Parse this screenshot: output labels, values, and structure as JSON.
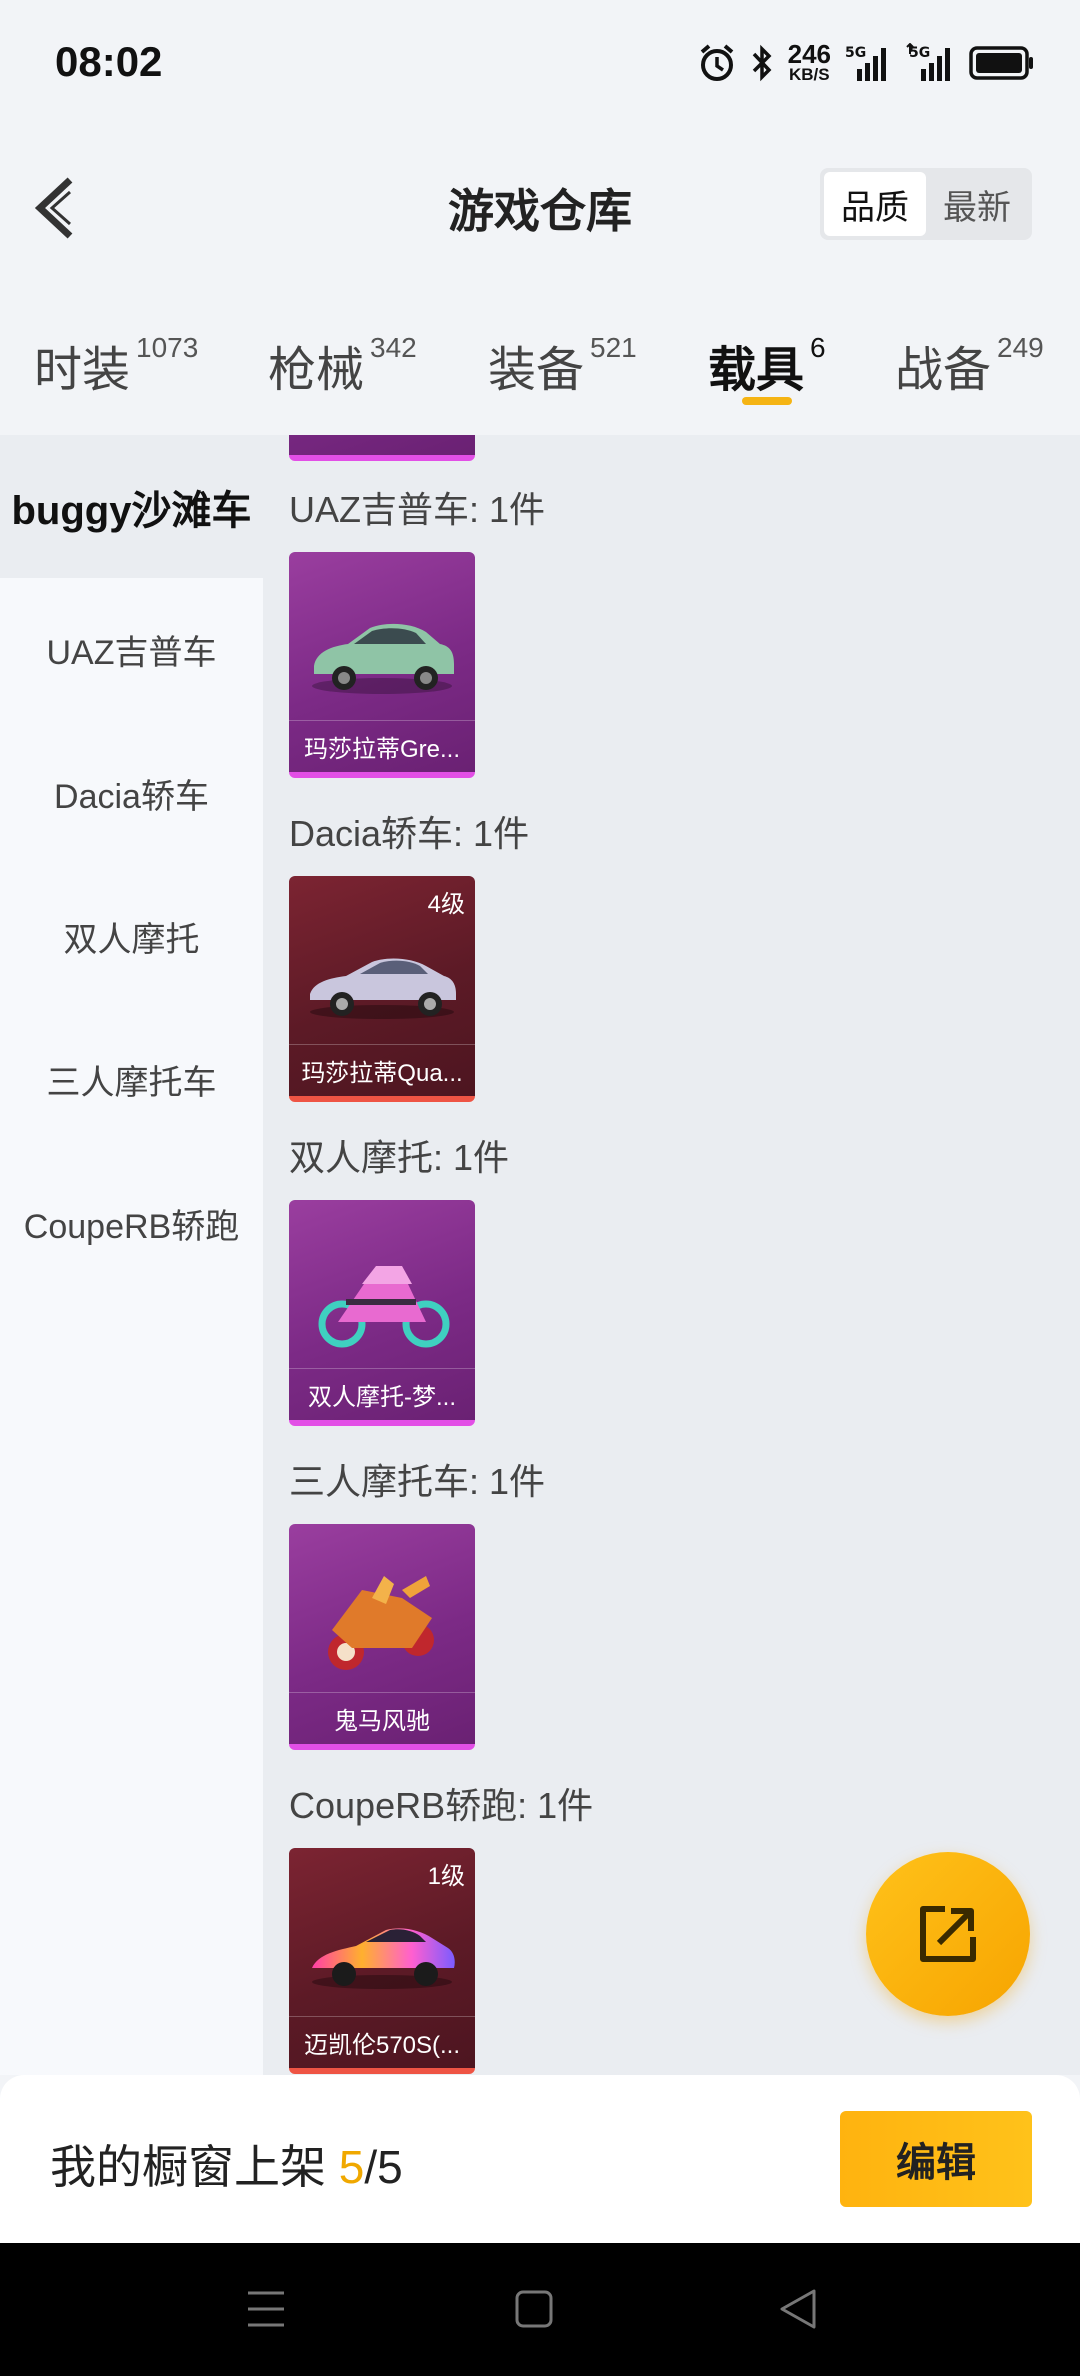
{
  "status_bar": {
    "time": "08:02",
    "speed_value": "246",
    "speed_unit": "KB/S",
    "net1": "5G",
    "net2": "5G"
  },
  "header": {
    "title": "游戏仓库",
    "sort_options": [
      "品质",
      "最新"
    ]
  },
  "tabs": [
    {
      "label": "时装",
      "count": "1073"
    },
    {
      "label": "枪械",
      "count": "342"
    },
    {
      "label": "装备",
      "count": "521"
    },
    {
      "label": "载具",
      "count": "6"
    },
    {
      "label": "战备",
      "count": "249"
    }
  ],
  "sidebar": {
    "items": [
      "buggy沙滩车",
      "UAZ吉普车",
      "Dacia轿车",
      "双人摩托",
      "三人摩托车",
      "CoupeRB轿跑"
    ]
  },
  "sections": [
    {
      "label": "UAZ吉普车: 1件",
      "item": {
        "name": "玛莎拉蒂Gre...",
        "level": ""
      }
    },
    {
      "label": "Dacia轿车: 1件",
      "item": {
        "name": "玛莎拉蒂Qua...",
        "level": "4级"
      }
    },
    {
      "label": "双人摩托: 1件",
      "item": {
        "name": "双人摩托-梦...",
        "level": ""
      }
    },
    {
      "label": "三人摩托车: 1件",
      "item": {
        "name": "鬼马风驰",
        "level": ""
      }
    },
    {
      "label": "CoupeRB轿跑: 1件",
      "item": {
        "name": "迈凯伦570S(...",
        "level": "1级"
      }
    }
  ],
  "bottom_bar": {
    "prefix": "我的橱窗上架 ",
    "current": "5",
    "total": "/5",
    "edit_label": "编辑"
  },
  "colors": {
    "accent": "#f5b414",
    "epic_border": "#e24fe6",
    "legend_border": "#ee5444"
  }
}
